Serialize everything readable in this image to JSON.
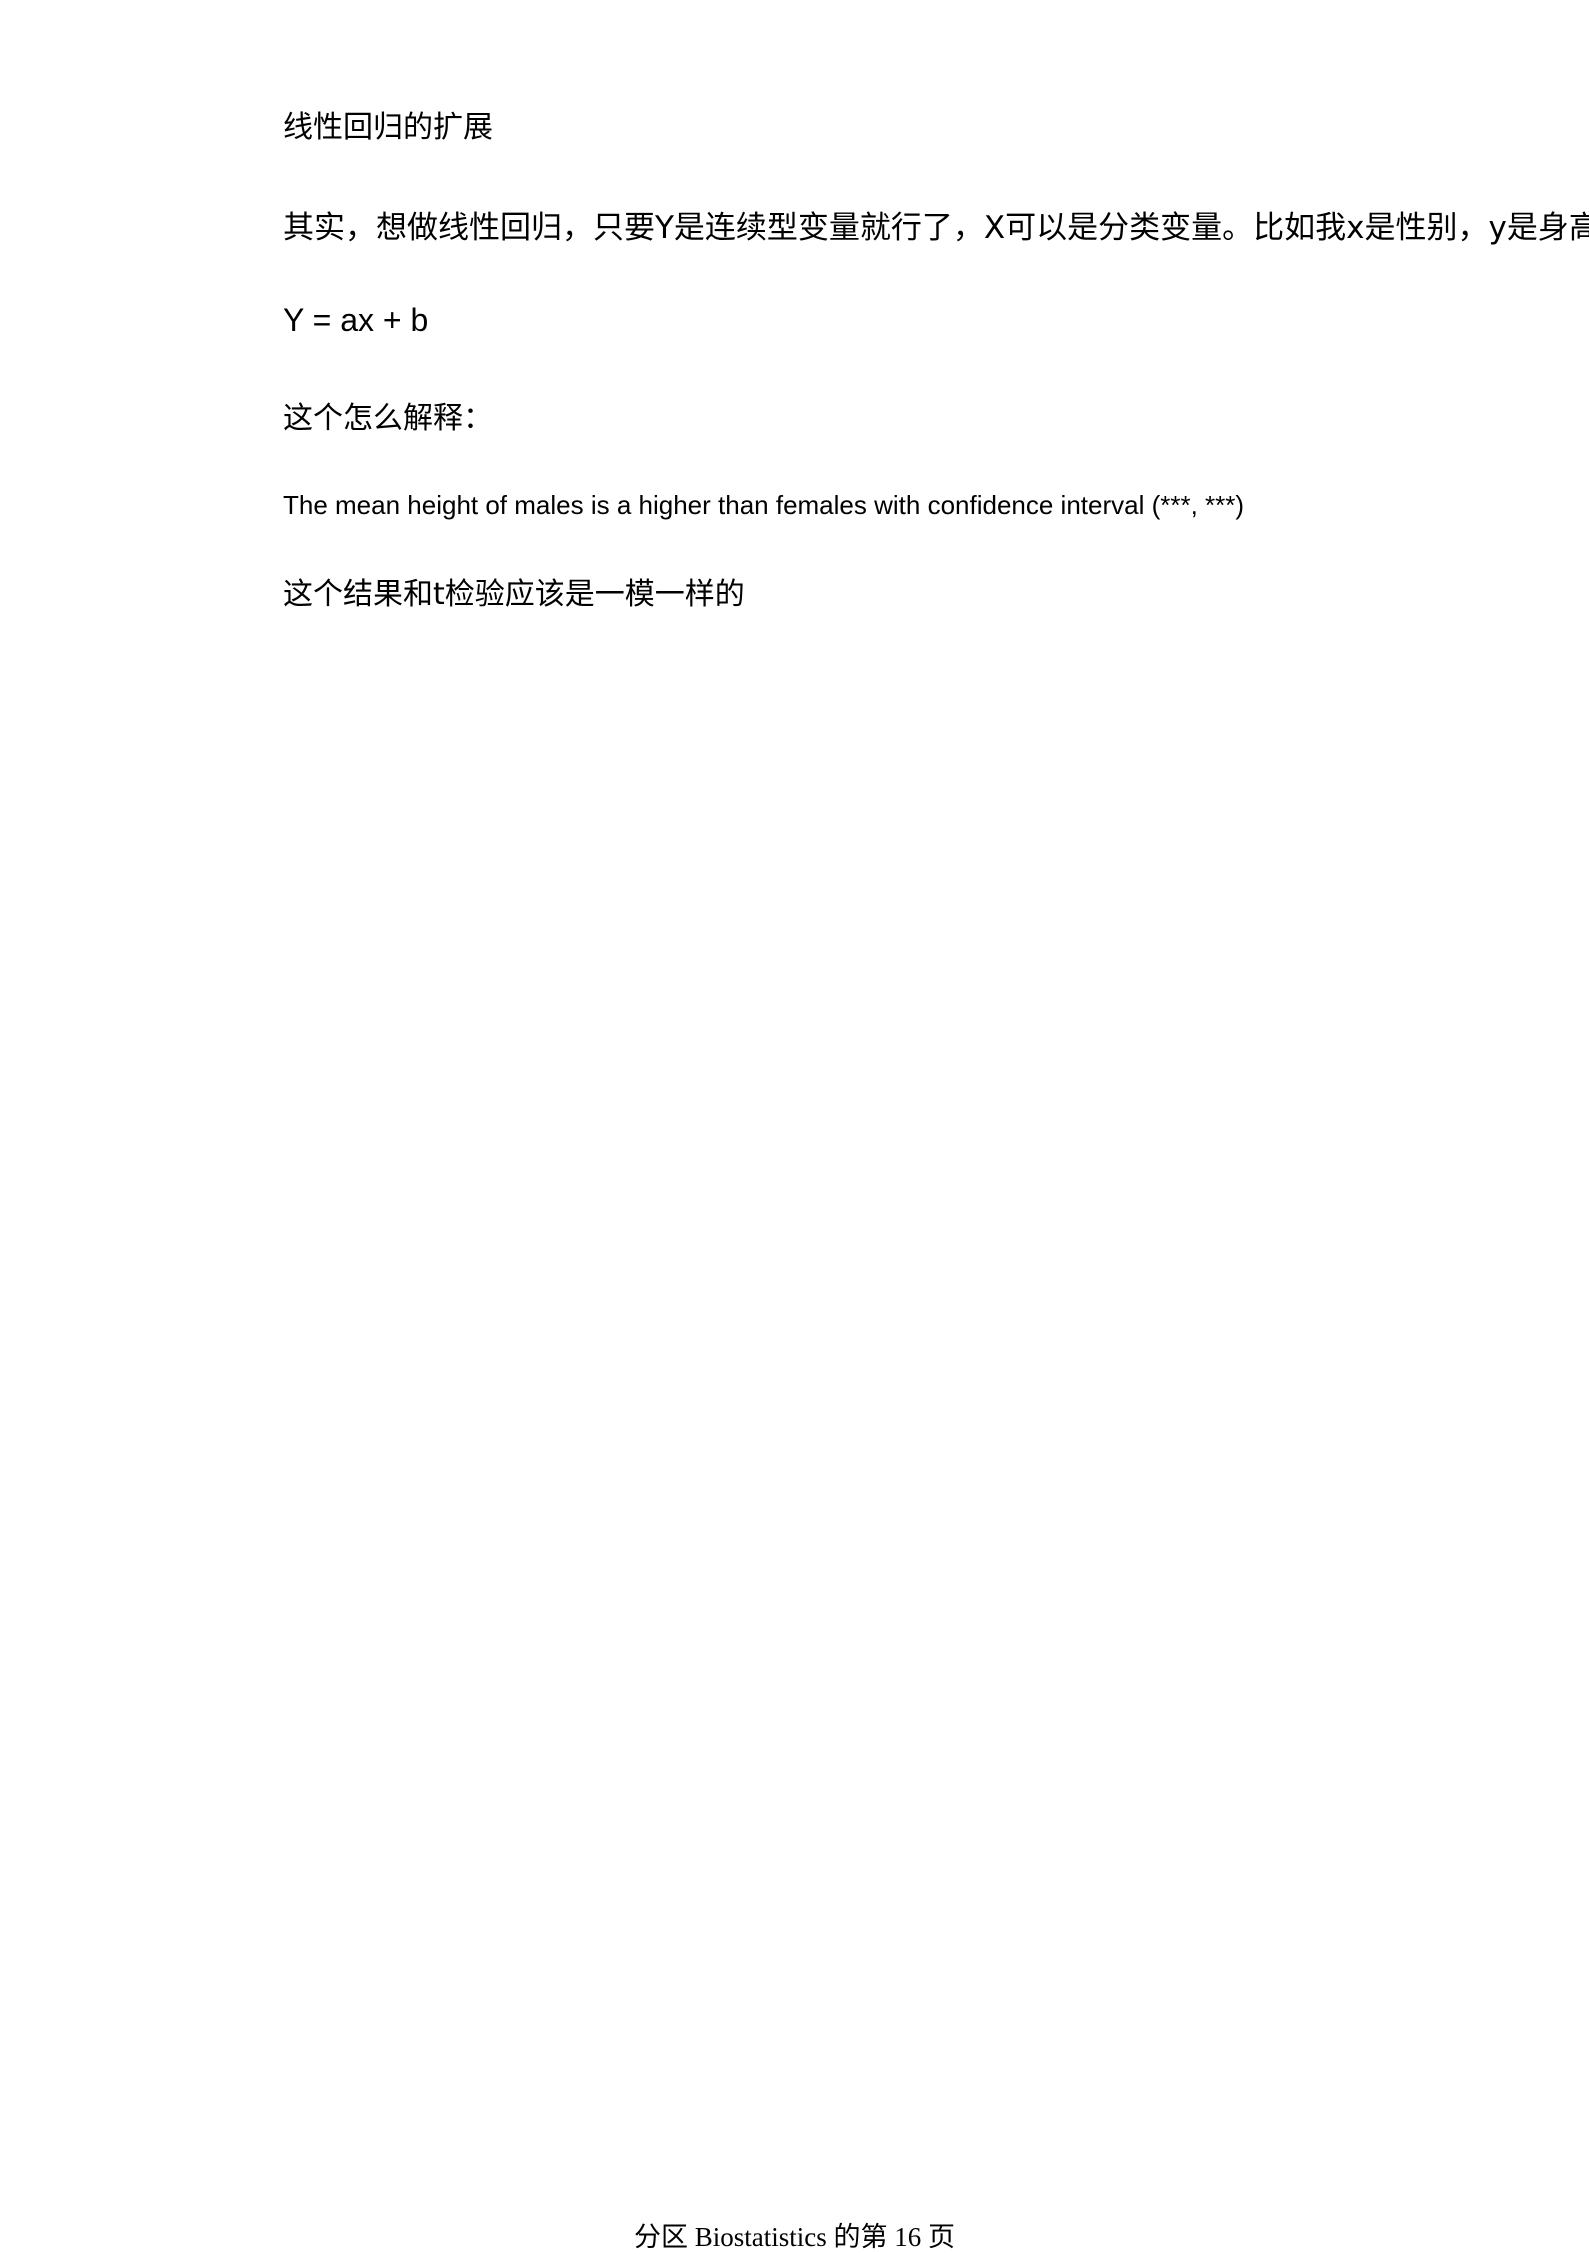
{
  "document": {
    "heading": "线性回归的扩展",
    "intro": "其实，想做线性回归，只要Y是连续型变量就行了，X可以是分类变量。比如我x是性别，y是身高",
    "formula": "Y = ax + b",
    "question": "这个怎么解释：",
    "interpretation": "The mean height of males is a higher than females with confidence interval (***, ***)",
    "conclusion": "这个结果和t检验应该是一模一样的"
  },
  "footer": {
    "page_label": "分区 Biostatistics 的第 16 页"
  }
}
